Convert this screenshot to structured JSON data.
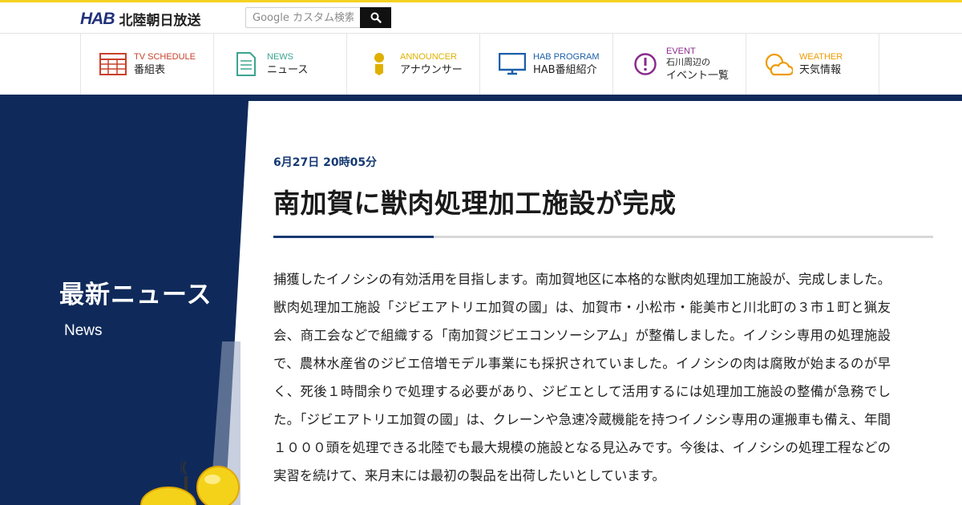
{
  "header": {
    "logo_mark": "HAB",
    "logo_text": "北陸朝日放送",
    "search_placeholder": "Google カスタム検索"
  },
  "nav": [
    {
      "en": "TV SCHEDULE",
      "jp": "番組表",
      "color": "#c8402a",
      "icon": "tv-schedule-icon"
    },
    {
      "en": "NEWS",
      "jp": "ニュース",
      "color": "#3aa58f",
      "icon": "news-document-icon"
    },
    {
      "en": "ANNOUNCER",
      "jp": "アナウンサー",
      "color": "#e0b000",
      "icon": "announcer-person-icon"
    },
    {
      "en": "HAB PROGRAM",
      "jp": "HAB番組紹介",
      "color": "#1d5fa8",
      "icon": "monitor-icon"
    },
    {
      "en": "EVENT",
      "jp_line1": "石川周辺の",
      "jp_line2": "イベント一覧",
      "color": "#8a2b8c",
      "icon": "exclamation-circle-icon"
    },
    {
      "en": "WEATHER",
      "jp": "天気情報",
      "color": "#ef9a00",
      "icon": "weather-sun-cloud-icon"
    }
  ],
  "side": {
    "title": "最新ニュース",
    "subtitle": "News"
  },
  "article": {
    "date": "6月27日 20時05分",
    "headline": "南加賀に獣肉処理加工施設が完成",
    "body": "捕獲したイノシシの有効活用を目指します。南加賀地区に本格的な獣肉処理加工施設が、完成しました。獣肉処理加工施設「ジビエアトリエ加賀の國」は、加賀市・小松市・能美市と川北町の３市１町と猟友会、商工会などで組織する「南加賀ジビエコンソーシアム」が整備しました。イノシシ専用の処理施設で、農林水産省のジビエ倍増モデル事業にも採択されていました。イノシシの肉は腐敗が始まるのが早く、死後１時間余りで処理する必要があり、ジビエとして活用するには処理加工施設の整備が急務でした。「ジビエアトリエ加賀の國」は、クレーンや急速冷蔵機能を持つイノシシ専用の運搬車も備え、年間１０００頭を処理できる北陸でも最大規模の施設となる見込みです。今後は、イノシシの処理工程などの実習を続けて、来月末には最初の製品を出荷したいとしています。"
  },
  "colors": {
    "brand_yellow": "#f4d21f",
    "navy": "#0f2a5a",
    "accent_blue": "#163a72"
  }
}
